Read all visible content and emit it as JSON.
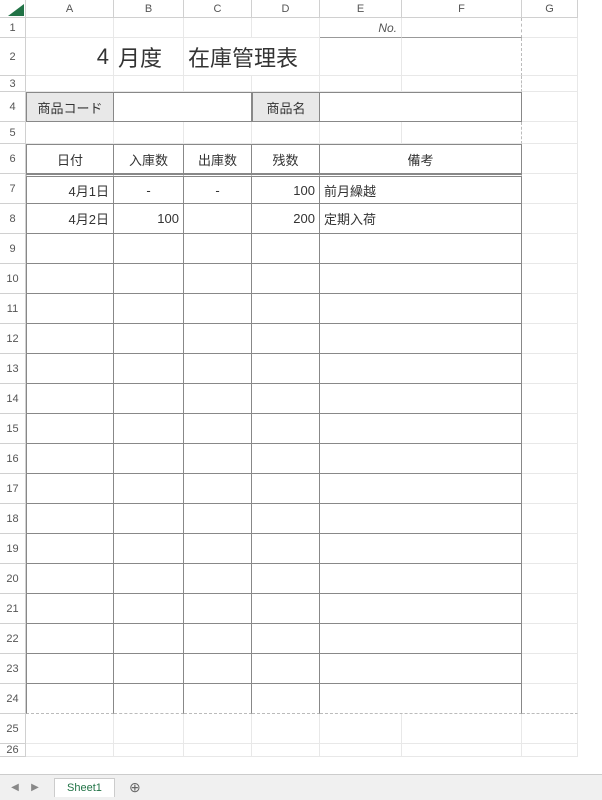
{
  "columns": [
    "A",
    "B",
    "C",
    "D",
    "E",
    "F",
    "G"
  ],
  "rowcount": 26,
  "header": {
    "no_label": "No.",
    "month": "4",
    "month_suffix": "月度",
    "title": "在庫管理表"
  },
  "labels": {
    "product_code": "商品コード",
    "product_name": "商品名"
  },
  "table": {
    "headers": {
      "date": "日付",
      "in": "入庫数",
      "out": "出庫数",
      "remain": "残数",
      "notes": "備考"
    },
    "rows": [
      {
        "date": "4月1日",
        "in": "-",
        "out": "-",
        "remain": "100",
        "notes": "前月繰越"
      },
      {
        "date": "4月2日",
        "in": "100",
        "out": "",
        "remain": "200",
        "notes": "定期入荷"
      }
    ]
  },
  "tabbar": {
    "sheet": "Sheet1"
  },
  "chart_data": {
    "type": "table",
    "title": "4 月度 在庫管理表",
    "columns": [
      "日付",
      "入庫数",
      "出庫数",
      "残数",
      "備考"
    ],
    "rows": [
      [
        "4月1日",
        "-",
        "-",
        100,
        "前月繰越"
      ],
      [
        "4月2日",
        100,
        "",
        200,
        "定期入荷"
      ]
    ]
  }
}
